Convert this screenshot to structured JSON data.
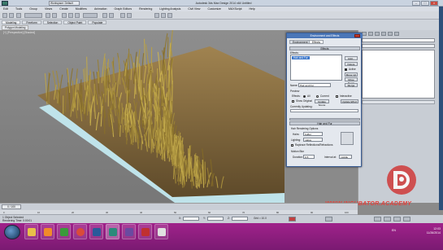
{
  "window": {
    "title": "Autodesk 3ds Max Design 2014 x64   Untitled",
    "workspace": "Workspace: Default"
  },
  "menubar": [
    "Edit",
    "Tools",
    "Group",
    "Views",
    "Create",
    "Modifiers",
    "Animation",
    "Graph Editors",
    "Rendering",
    "Lighting Analysis",
    "Civil View",
    "Customize",
    "MAXScript",
    "Help"
  ],
  "ribbon": {
    "tabs": [
      "Modeling",
      "Freeform",
      "Selection",
      "Object Paint",
      "Populate"
    ],
    "subtab": "Polygon Modeling"
  },
  "viewport": {
    "label": "[+] [Perspective] [Shaded]"
  },
  "dialog": {
    "title": "Environment and Effects",
    "tabs": [
      "Environment",
      "Effects"
    ],
    "rollout_effects": "Effects",
    "effects_label": "Effects:",
    "effect_item": "Hair and Fur",
    "buttons": [
      "Add...",
      "Delete",
      "Active",
      "Move Up",
      "Move Down",
      "Merge"
    ],
    "name_label": "Name:",
    "name_value": "Hair and Fur",
    "preview_label": "Preview",
    "preview_effects": "Effects:",
    "preview_all": "All",
    "preview_current": "Current",
    "interactive": "Interactive",
    "show_original": "Show Original",
    "update_scene": "Update Scene",
    "update_effect": "Update Effect",
    "currently_updating": "Currently Updating:",
    "rollout_hair": "Hair and Fur",
    "hair_rendering_options": "Hair Rendering Options",
    "hairs_label": "Hairs:",
    "hairs_value": "buffer",
    "lighting_label": "Lighting:",
    "lighting_value": "native",
    "raytrace_label": "Raytrace Reflections/Refractions",
    "motion_blur": "Motion Blur",
    "duration_label": "Duration:",
    "duration_value": "0.5",
    "interval_label": "Interval at:",
    "interval_value": "middle"
  },
  "timeline": {
    "position": "0 / 100",
    "ticks": [
      "0",
      "10",
      "20",
      "30",
      "40",
      "50",
      "60",
      "70",
      "80",
      "90",
      "100"
    ]
  },
  "status": {
    "line1": "1 Object Selected",
    "line2": "Rendering Time: 0:00:01",
    "x_label": "X:",
    "y_label": "Y:",
    "z_label": "Z:",
    "grid": "Grid = 10.0"
  },
  "taskbar": {
    "time": "12:03",
    "date": "11/26/2014",
    "lang": "EN"
  },
  "watermark": "WWW.INCUBATOR.ACADEMY",
  "colors": {
    "taskbar": "#8e1f84",
    "dialog_title": "#4a76b8",
    "watermark": "#e4403a"
  }
}
